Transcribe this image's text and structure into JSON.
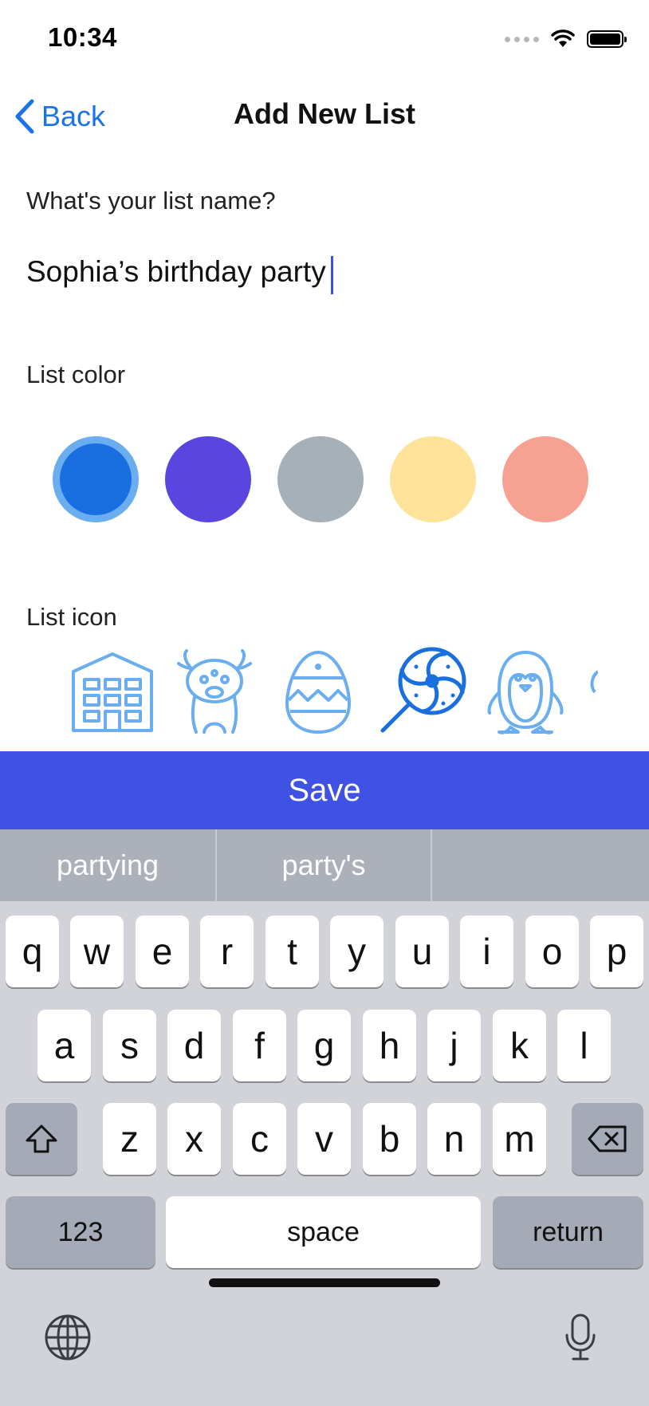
{
  "status_bar": {
    "time": "10:34"
  },
  "nav": {
    "back_label": "Back",
    "title": "Add New List"
  },
  "form": {
    "name_label": "What's your list name?",
    "name_value": "Sophia’s birthday party",
    "color_label": "List color",
    "colors": [
      "#1a6fe0",
      "#5b45e0",
      "#a5b0b8",
      "#ffe39a",
      "#f7a192"
    ],
    "selected_color_index": 0,
    "icon_label": "List icon",
    "icons": [
      "building-icon",
      "monster-icon",
      "easter-egg-icon",
      "lollipop-icon",
      "penguin-icon",
      "partial-icon"
    ],
    "selected_icon_index": 3
  },
  "save_label": "Save",
  "keyboard": {
    "suggestions": [
      "partying",
      "party's",
      ""
    ],
    "row1": [
      "q",
      "w",
      "e",
      "r",
      "t",
      "y",
      "u",
      "i",
      "o",
      "p"
    ],
    "row2": [
      "a",
      "s",
      "d",
      "f",
      "g",
      "h",
      "j",
      "k",
      "l"
    ],
    "row3": [
      "z",
      "x",
      "c",
      "v",
      "b",
      "n",
      "m"
    ],
    "numbers_label": "123",
    "space_label": "space",
    "return_label": "return"
  },
  "accent_color": "#4052e3",
  "link_color": "#1a73e8"
}
